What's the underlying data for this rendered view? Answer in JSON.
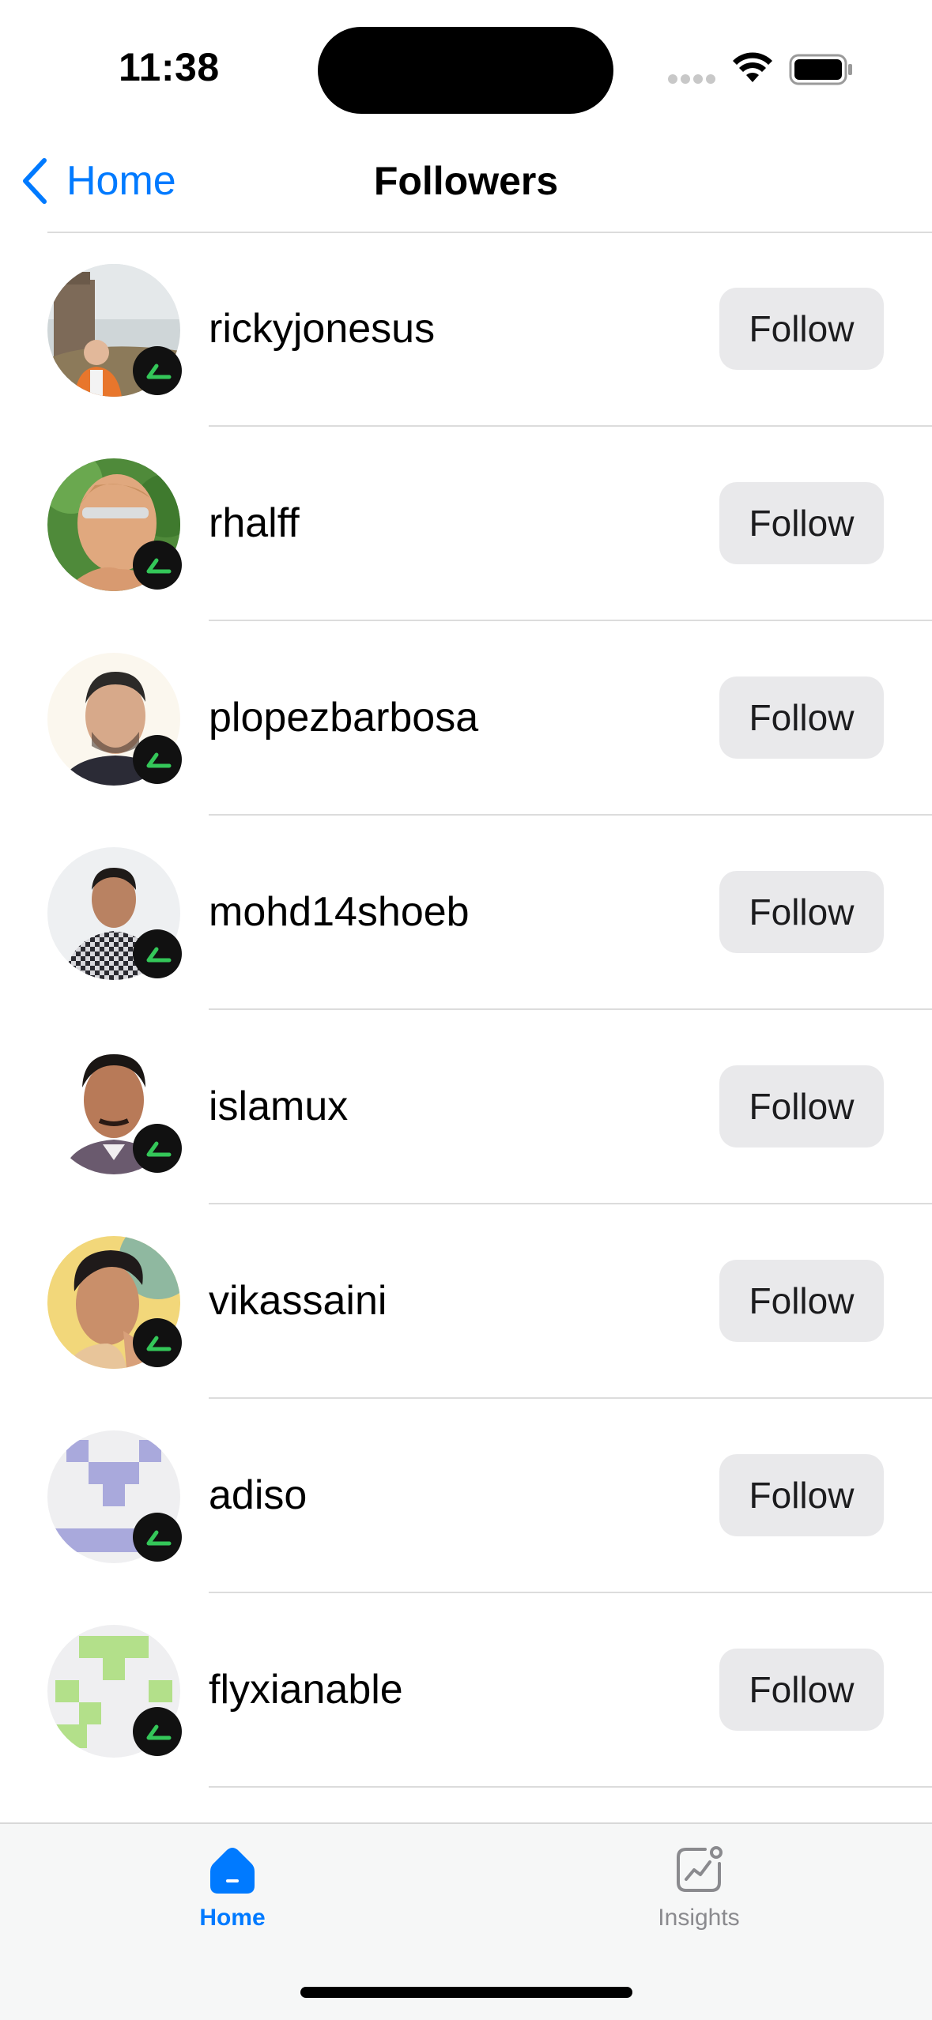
{
  "status_bar": {
    "time": "11:38",
    "icons": [
      "cellular-signal-icon",
      "wifi-icon",
      "battery-icon"
    ]
  },
  "nav": {
    "back_label": "Home",
    "title": "Followers"
  },
  "followers": [
    {
      "username": "rickyjonesus",
      "button": "Follow"
    },
    {
      "username": "rhalff",
      "button": "Follow"
    },
    {
      "username": "plopezbarbosa",
      "button": "Follow"
    },
    {
      "username": "mohd14shoeb",
      "button": "Follow"
    },
    {
      "username": "islamux",
      "button": "Follow"
    },
    {
      "username": "vikassaini",
      "button": "Follow"
    },
    {
      "username": "adiso",
      "button": "Follow"
    },
    {
      "username": "flyxianable",
      "button": "Follow"
    }
  ],
  "tabs": [
    {
      "label": "Home",
      "icon": "home-icon",
      "selected": true
    },
    {
      "label": "Insights",
      "icon": "insights-chart-icon",
      "selected": false
    }
  ],
  "colors": {
    "accent": "#007aff",
    "badge_arrow": "#34c759",
    "button_bg": "#e9e9eb",
    "inactive_tab": "#8a8a8e"
  }
}
